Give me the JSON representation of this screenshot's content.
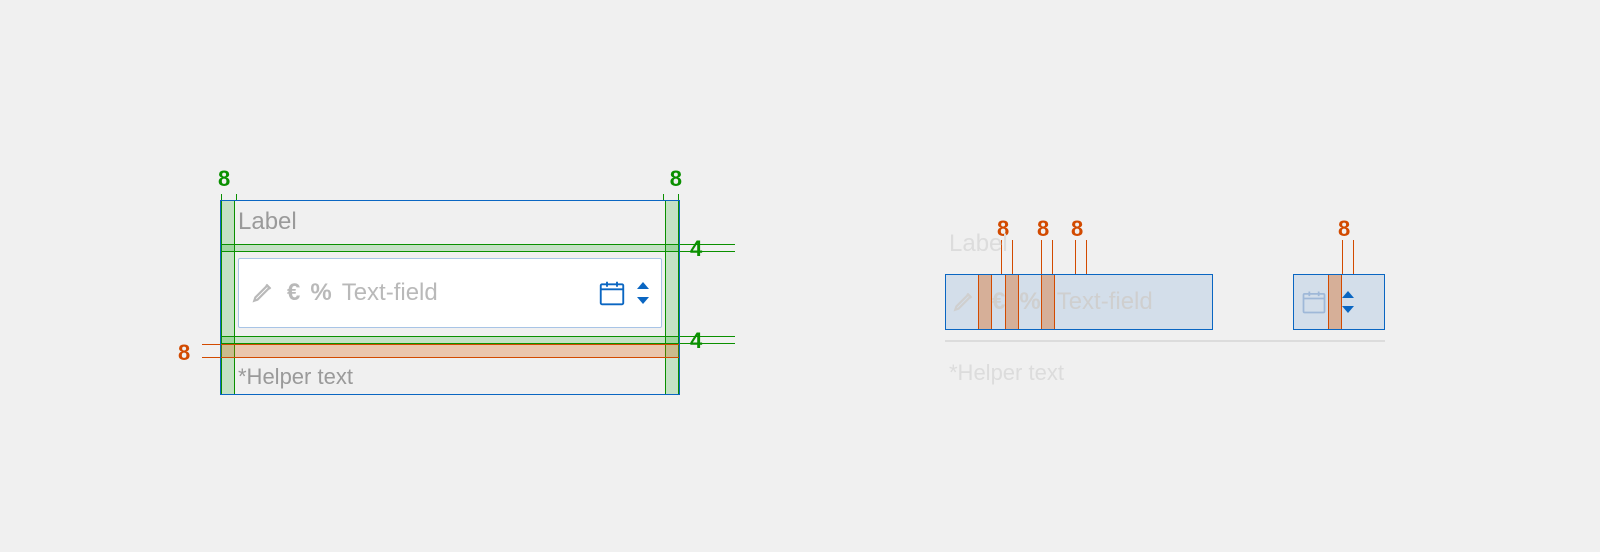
{
  "left": {
    "label": "Label",
    "placeholder": "Text-field",
    "helper": "*Helper text",
    "euro_symbol": "€",
    "percent_symbol": "%",
    "measure_8_top_left": "8",
    "measure_8_top_right": "8",
    "measure_4_top": "4",
    "measure_4_bottom": "4",
    "measure_8_orange_left": "8"
  },
  "right": {
    "label": "Label",
    "placeholder": "Text-field",
    "helper": "*Helper text",
    "euro_symbol": "€",
    "percent_symbol": "%",
    "measure_8_a": "8",
    "measure_8_b": "8",
    "measure_8_c": "8",
    "measure_8_d": "8"
  },
  "colors": {
    "green": "#0a9000",
    "orange": "#d24a00",
    "blue": "#0a66c2",
    "grey_text": "#9a9a9a"
  }
}
